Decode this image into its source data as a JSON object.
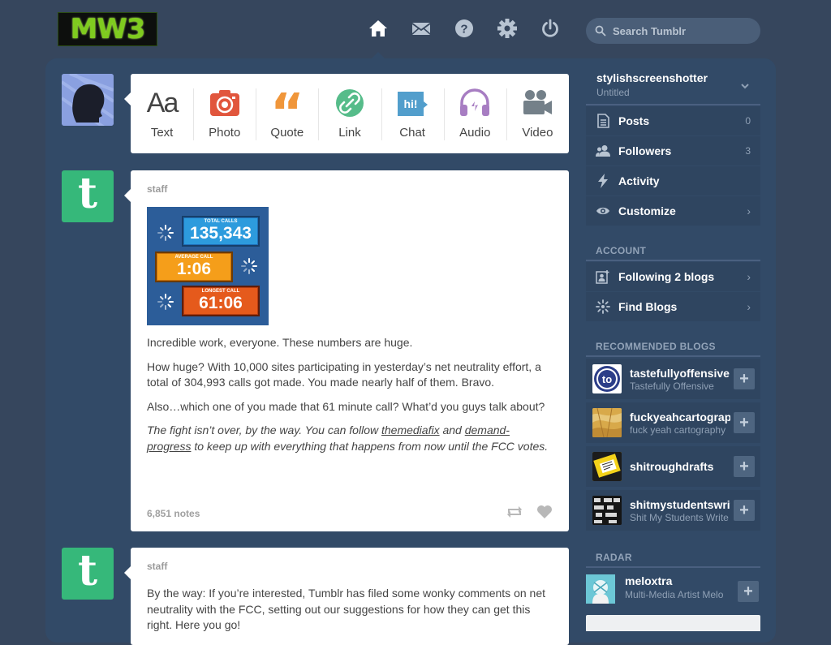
{
  "header": {
    "logo_text": "MW3",
    "nav_icons": [
      "home-icon",
      "mail-icon",
      "help-icon",
      "gear-icon",
      "power-icon"
    ],
    "search_placeholder": "Search Tumblr"
  },
  "post_types": [
    {
      "label": "Text",
      "icon": "text-icon",
      "color": "#444444"
    },
    {
      "label": "Photo",
      "icon": "camera-icon",
      "color": "#e1563d"
    },
    {
      "label": "Quote",
      "icon": "quote-icon",
      "color": "#f0963a"
    },
    {
      "label": "Link",
      "icon": "link-icon",
      "color": "#56bc8a"
    },
    {
      "label": "Chat",
      "icon": "chat-icon",
      "color": "#529ecc"
    },
    {
      "label": "Audio",
      "icon": "headphones-icon",
      "color": "#a77dc2"
    },
    {
      "label": "Video",
      "icon": "video-camera-icon",
      "color": "#748089"
    }
  ],
  "posts": [
    {
      "author": "staff",
      "image": {
        "total_label": "TOTAL CALLS",
        "total_value": "135,343",
        "avg_label": "AVERAGE CALL",
        "avg_value": "1:06",
        "longest_label": "LONGEST CALL",
        "longest_value": "61:06"
      },
      "paragraphs": [
        "Incredible work, everyone. These numbers are huge.",
        "How huge? With 10,000 sites participating in yesterday’s net neutrality effort, a total of 304,993 calls got made. You made nearly half of them. Bravo.",
        "Also…which one of you made that 61 minute call? What’d you guys talk about?"
      ],
      "italic": {
        "pre": "The fight isn’t over, by the way. You can follow ",
        "link1": "themediafix",
        "mid": " and ",
        "link2": "demand-progress",
        "post": " to keep up with everything that happens from now until the FCC votes."
      },
      "notes": "6,851 notes"
    },
    {
      "author": "staff",
      "paragraph": "By the way: If you’re interested, Tumblr has filed some wonky comments on net neutrality with the FCC, setting out our suggestions for how they can get this right. Here you go!"
    }
  ],
  "sidebar": {
    "blog_name": "stylishscreenshotter",
    "blog_title": "Untitled",
    "rows": [
      {
        "label": "Posts",
        "count": "0",
        "icon": "posts-icon"
      },
      {
        "label": "Followers",
        "count": "3",
        "icon": "followers-icon"
      },
      {
        "label": "Activity",
        "icon": "lightning-icon"
      },
      {
        "label": "Customize",
        "icon": "eye-icon"
      }
    ],
    "account_title": "ACCOUNT",
    "account_rows": [
      {
        "label": "Following 2 blogs",
        "icon": "following-icon"
      },
      {
        "label": "Find Blogs",
        "icon": "find-blogs-icon"
      }
    ],
    "recommended_title": "RECOMMENDED BLOGS",
    "recommended": [
      {
        "name": "tastefullyoffensive",
        "desc": "Tastefully Offensive"
      },
      {
        "name": "fuckyeahcartography",
        "desc": "fuck yeah cartography"
      },
      {
        "name": "shitroughdrafts",
        "desc": ""
      },
      {
        "name": "shitmystudentswrite",
        "desc": "Shit My Students Write"
      }
    ],
    "radar_title": "RADAR",
    "radar": {
      "name": "meloxtra",
      "desc": "Multi-Media Artist Melo"
    }
  },
  "colors": {
    "background": "#36465d",
    "panel": "#324a67",
    "tumblr_green": "#36b87a"
  }
}
